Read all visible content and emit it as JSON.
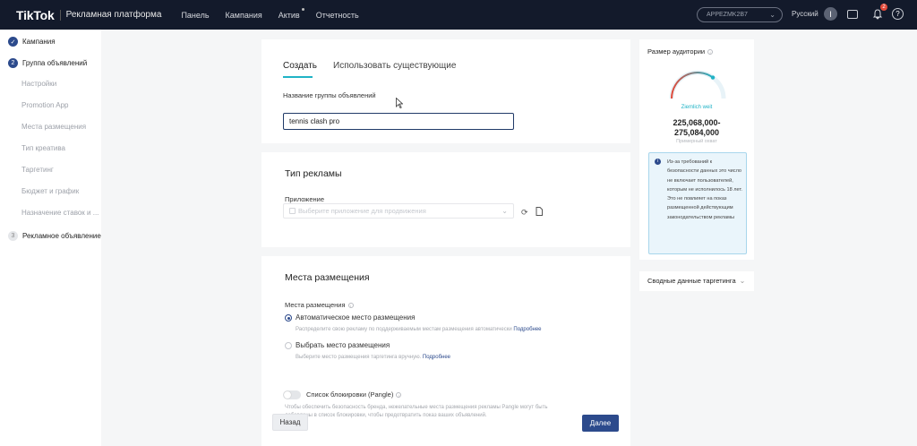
{
  "topbar": {
    "logo": "TikTok",
    "subtitle": "Рекламная платформа",
    "nav": [
      "Панель",
      "Кампания",
      "Актив",
      "Отчетность"
    ],
    "account": "APPEZMK2B7",
    "language": "Русский",
    "avatar": "I",
    "notification_count": "2",
    "help": "?"
  },
  "sidebar": {
    "items": [
      {
        "label": "Кампания",
        "state": "done"
      },
      {
        "label": "Группа объявлений",
        "state": "active",
        "number": "2"
      },
      {
        "label": "Настройки"
      },
      {
        "label": "Promotion App"
      },
      {
        "label": "Места размещения"
      },
      {
        "label": "Тип креатива"
      },
      {
        "label": "Таргетинг"
      },
      {
        "label": "Бюджет и график"
      },
      {
        "label": "Назначение ставок и ..."
      },
      {
        "label": "Рекламное объявление",
        "state": "pending",
        "number": "3"
      }
    ]
  },
  "create_card": {
    "tabs": [
      "Создать",
      "Использовать существующие"
    ],
    "name_label": "Название группы объявлений",
    "name_value": "tennis clash pro"
  },
  "ad_type_card": {
    "title": "Тип рекламы",
    "app_label": "Приложение",
    "app_placeholder": "Выберите приложение для продвижения"
  },
  "placement_card": {
    "title": "Места размещения",
    "label": "Места размещения",
    "auto_option": "Автоматическое место размещения",
    "auto_hint": "Распределите свою рекламу по поддерживаемым местам размещения автоматически",
    "auto_link": "Подробнее",
    "manual_option": "Выбрать место размещения",
    "manual_hint": "Выберите место размещения таргетинга вручную.",
    "manual_link": "Подробнее",
    "blocklist_label": "Список блокировки (Pangle)",
    "blocklist_hint_1": "Чтобы обеспечить безопасность бренда, нежелательные места размещения рекламы Pangle могут быть",
    "blocklist_hint_2": "добавлены в список блокировки, чтобы предотвратить показ ваших объявлений."
  },
  "buttons": {
    "back": "Назад",
    "next": "Далее"
  },
  "audience": {
    "title": "Размер аудитории",
    "gauge_label": "Ziemlich weit",
    "range_line1": "225,068,000-",
    "range_line2": "275,084,000",
    "note": "Примерный охват",
    "gauge_level": 0.7,
    "info_text": "Из-за требований к безопасности данных это число не включает пользователей, которым не исполнилось 18 лет. Это не повлияет на показ размещенной действующим законодательством рекламы",
    "summary": "Сводные данные таргетинга"
  },
  "colors": {
    "topbar": "#131a2b",
    "primary": "#2c4a8c",
    "accent": "#20b3c6"
  }
}
